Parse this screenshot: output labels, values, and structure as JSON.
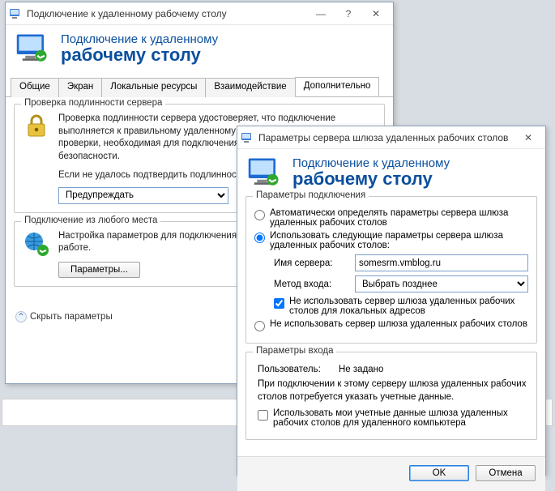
{
  "win1": {
    "title": "Подключение к удаленному рабочему столу",
    "banner": {
      "line1": "Подключение к удаленному",
      "line2": "рабочему столу"
    },
    "tabs": [
      "Общие",
      "Экран",
      "Локальные ресурсы",
      "Взаимодействие",
      "Дополнительно"
    ],
    "active_tab": 4,
    "group1": {
      "legend": "Проверка подлинности сервера",
      "text1": "Проверка подлинности сервера удостоверяет, что подключение выполняется к правильному удаленному компьютеру. Строгость проверки, необходимая для подключения, определяется политикой безопасности.",
      "text2": "Если не удалось подтвердить подлинность удаленного компьютера:",
      "dropdown": "Предупреждать"
    },
    "group2": {
      "legend": "Подключение из любого места",
      "text": "Настройка параметров для подключения через шлюз при удаленной работе.",
      "button": "Параметры..."
    },
    "hide": "Скрыть параметры"
  },
  "win2": {
    "title": "Параметры сервера шлюза удаленных рабочих столов",
    "banner": {
      "line1": "Подключение к удаленному",
      "line2": "рабочему столу"
    },
    "group1": {
      "legend": "Параметры подключения",
      "radio1": "Автоматически определять параметры сервера шлюза удаленных рабочих столов",
      "radio2": "Использовать следующие параметры сервера шлюза удаленных рабочих столов:",
      "server_label": "Имя сервера:",
      "server_value": "somesrm.vmblog.ru",
      "method_label": "Метод входа:",
      "method_value": "Выбрать позднее",
      "check_bypass": "Не использовать сервер шлюза удаленных рабочих столов для локальных адресов",
      "radio3": "Не использовать сервер шлюза удаленных рабочих столов"
    },
    "group2": {
      "legend": "Параметры входа",
      "user_label": "Пользователь:",
      "user_value": "Не задано",
      "info": "При подключении к этому серверу шлюза удаленных рабочих столов потребуется указать учетные данные.",
      "check_creds": "Использовать мои учетные данные шлюза удаленных рабочих столов для удаленного компьютера"
    },
    "ok": "OK",
    "cancel": "Отмена"
  }
}
